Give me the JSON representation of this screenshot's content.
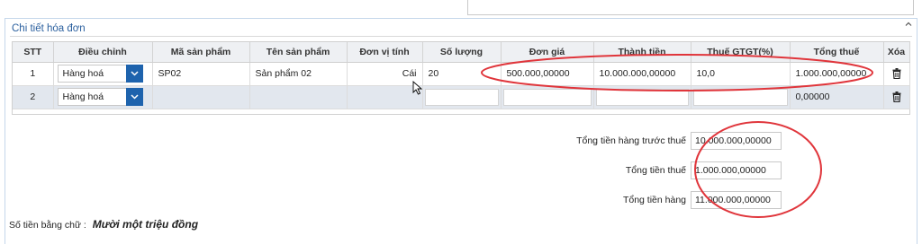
{
  "panel": {
    "title": "Chi tiết hóa đơn"
  },
  "table": {
    "columns": [
      "STT",
      "Điều chỉnh",
      "Mã sản phẩm",
      "Tên sản phẩm",
      "Đơn vị tính",
      "Số lượng",
      "Đơn giá",
      "Thành tiền",
      "Thuế GTGT(%)",
      "Tổng thuế",
      "Xóa"
    ],
    "rows": [
      {
        "stt": "1",
        "dieu_chinh": "Hàng hoá",
        "ma_sp": "SP02",
        "ten_sp": "Sản phẩm 02",
        "dvt": "Cái",
        "so_luong": "20",
        "don_gia": "500.000,00000",
        "thanh_tien": "10.000.000,00000",
        "thue_pct": "10,0",
        "tong_thue": "1.000.000,00000"
      },
      {
        "stt": "2",
        "dieu_chinh": "Hàng hoá",
        "ma_sp": "",
        "ten_sp": "",
        "dvt": "",
        "so_luong": "",
        "don_gia": "",
        "thanh_tien": "",
        "thue_pct": "",
        "tong_thue": "0,00000"
      }
    ]
  },
  "summary": {
    "truoc_thue_label": "Tổng tiền hàng trước thuế",
    "truoc_thue_value": "10.000.000,00000",
    "tien_thue_label": "Tổng tiền thuế",
    "tien_thue_value": "1.000.000,00000",
    "tien_hang_label": "Tổng tiền hàng",
    "tien_hang_value": "11.000.000,00000"
  },
  "words": {
    "label": "Số tiền bằng chữ :",
    "value": "Mười một triệu đồng"
  },
  "icons": {
    "collapse": "chevron-up-icon",
    "dropdown": "chevron-down-icon",
    "delete": "trash-icon",
    "cursor": "mouse-pointer-icon"
  },
  "colors": {
    "accent": "#1e63ad",
    "title": "#2a5f9e",
    "annotation": "#e0353b"
  }
}
